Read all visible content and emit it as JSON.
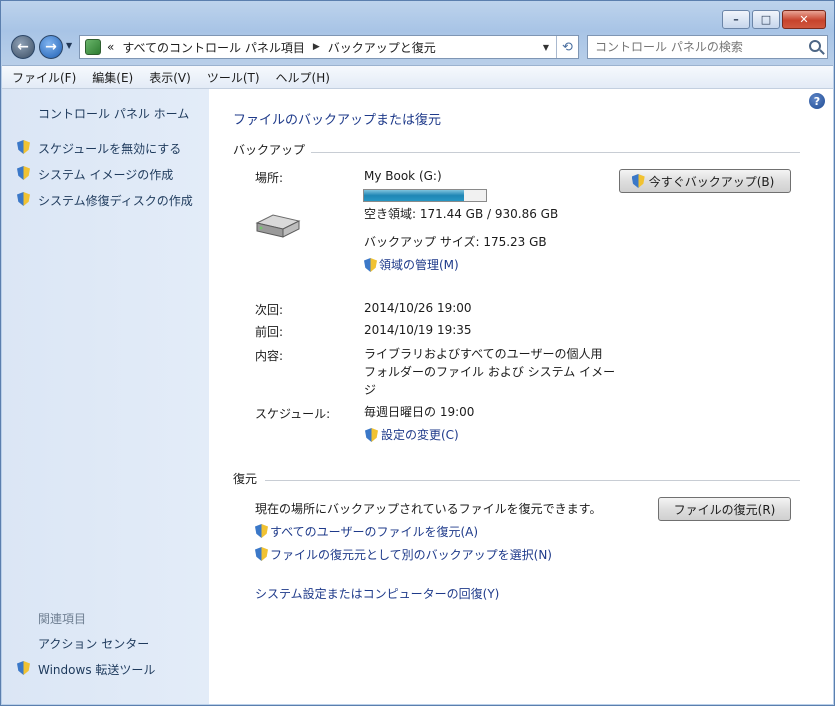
{
  "window": {
    "minimize_glyph": "–",
    "maximize_glyph": "□",
    "close_glyph": "✕"
  },
  "address": {
    "prefix": "«",
    "crumbs": [
      "すべてのコントロール パネル項目",
      "バックアップと復元"
    ],
    "separator": "▶"
  },
  "search": {
    "placeholder": "コントロール パネルの検索"
  },
  "menu": [
    "ファイル(F)",
    "編集(E)",
    "表示(V)",
    "ツール(T)",
    "ヘルプ(H)"
  ],
  "sidebar": {
    "home": "コントロール パネル ホーム",
    "tasks": [
      "スケジュールを無効にする",
      "システム イメージの作成",
      "システム修復ディスクの作成"
    ],
    "related_heading": "関連項目",
    "related": [
      "アクション センター",
      "Windows 転送ツール"
    ]
  },
  "main": {
    "title": "ファイルのバックアップまたは復元",
    "backup": {
      "heading": "バックアップ",
      "location_label": "場所:",
      "location_value": "My Book (G:)",
      "disk_used_fraction": 0.816,
      "free_space": "空き領域: 171.44 GB / 930.86 GB",
      "backup_size": "バックアップ サイズ: 175.23 GB",
      "manage_space": "領域の管理(M)",
      "backup_now": "今すぐバックアップ(B)",
      "next_label": "次回:",
      "next_value": "2014/10/26 19:00",
      "last_label": "前回:",
      "last_value": "2014/10/19 19:35",
      "contents_label": "内容:",
      "contents_lines": [
        "ライブラリおよびすべてのユーザーの個人用",
        "フォルダーのファイル および システム イメー",
        "ジ"
      ],
      "schedule_label": "スケジュール:",
      "schedule_value": "毎週日曜日の 19:00",
      "change_settings": "設定の変更(C)"
    },
    "restore": {
      "heading": "復元",
      "description": "現在の場所にバックアップされているファイルを復元できます。",
      "restore_button": "ファイルの復元(R)",
      "all_users": "すべてのユーザーのファイルを復元(A)",
      "select_other": "ファイルの復元元として別のバックアップを選択(N)",
      "recover_system": "システム設定またはコンピューターの回復(Y)"
    }
  }
}
